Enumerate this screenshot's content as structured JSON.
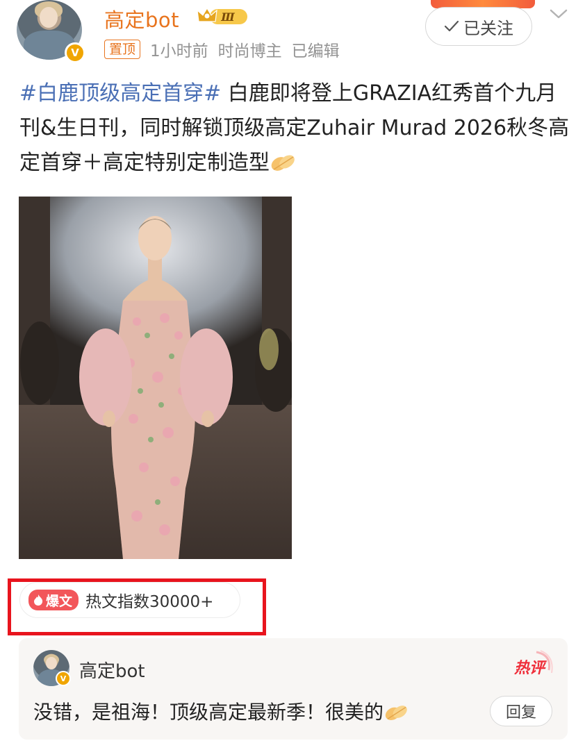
{
  "header": {
    "username": "高定bot",
    "vip_level": "Ⅲ",
    "follow_label": "已关注",
    "pin_label": "置顶",
    "time": "1小时前",
    "author_type": "时尚博主",
    "edited_label": "已编辑",
    "icons": [
      "crown-icon",
      "check-icon",
      "chevron-down-icon",
      "verified-icon"
    ]
  },
  "post": {
    "hashtag": "#白鹿顶级高定首穿#",
    "text": " 白鹿即将登上GRAZIA红秀首个九月刊&生日刊，同时解锁顶级高定Zuhair Murad 2026秋冬高定首穿＋高定特别定制造型",
    "emoji": "folded-hands-emoji"
  },
  "hot_index": {
    "tag": "爆文",
    "text": "热文指数30000+",
    "highlight_color": "#e8141d"
  },
  "comment": {
    "username": "高定bot",
    "badge": "热评",
    "text": "没错，是祖海！顶级高定最新季！很美的",
    "reply_label": "回复"
  },
  "colors": {
    "username": "#e8741e",
    "hashtag": "#4a6fb5",
    "hot_tag": "#f2565a"
  }
}
